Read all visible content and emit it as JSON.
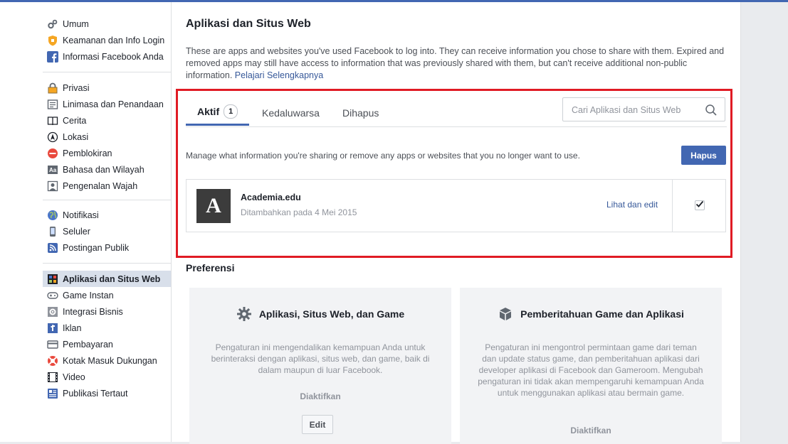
{
  "sidebar": {
    "items": [
      {
        "label": "Umum",
        "icon": "gears-icon"
      },
      {
        "label": "Keamanan dan Info Login",
        "icon": "shield-icon"
      },
      {
        "label": "Informasi Facebook Anda",
        "icon": "facebook-icon"
      },
      {
        "label": "Privasi",
        "icon": "lock-icon"
      },
      {
        "label": "Linimasa dan Penandaan",
        "icon": "timeline-icon"
      },
      {
        "label": "Cerita",
        "icon": "book-icon"
      },
      {
        "label": "Lokasi",
        "icon": "location-icon"
      },
      {
        "label": "Pemblokiran",
        "icon": "block-icon"
      },
      {
        "label": "Bahasa dan Wilayah",
        "icon": "language-icon"
      },
      {
        "label": "Pengenalan Wajah",
        "icon": "face-icon"
      },
      {
        "label": "Notifikasi",
        "icon": "globe-icon"
      },
      {
        "label": "Seluler",
        "icon": "mobile-icon"
      },
      {
        "label": "Postingan Publik",
        "icon": "rss-icon"
      },
      {
        "label": "Aplikasi dan Situs Web",
        "icon": "apps-icon",
        "active": true
      },
      {
        "label": "Game Instan",
        "icon": "gamepad-icon"
      },
      {
        "label": "Integrasi Bisnis",
        "icon": "business-icon"
      },
      {
        "label": "Iklan",
        "icon": "ads-icon"
      },
      {
        "label": "Pembayaran",
        "icon": "payment-icon"
      },
      {
        "label": "Kotak Masuk Dukungan",
        "icon": "lifebuoy-icon"
      },
      {
        "label": "Video",
        "icon": "film-icon"
      },
      {
        "label": "Publikasi Tertaut",
        "icon": "publication-icon"
      }
    ]
  },
  "main": {
    "title": "Aplikasi dan Situs Web",
    "description": "These are apps and websites you've used Facebook to log into. They can receive information you chose to share with them. Expired and removed apps may still have access to information that was previously shared with them, but can't receive additional non-public information.",
    "learn_more": "Pelajari Selengkapnya",
    "tabs": [
      {
        "label": "Aktif",
        "badge": "1",
        "active": true
      },
      {
        "label": "Kedaluwarsa"
      },
      {
        "label": "Dihapus"
      }
    ],
    "search_placeholder": "Cari Aplikasi dan Situs Web",
    "manage_text": "Manage what information you're sharing or remove any apps or websites that you no longer want to use.",
    "remove_button": "Hapus",
    "app": {
      "logo_letter": "A",
      "name": "Academia.edu",
      "added": "Ditambahkan pada 4 Mei 2015",
      "view_edit": "Lihat dan edit",
      "checked": true
    },
    "preferences_title": "Preferensi",
    "cards": [
      {
        "title": "Aplikasi, Situs Web, dan Game",
        "icon": "gear-icon",
        "text": "Pengaturan ini mengendalikan kemampuan Anda untuk berinteraksi dengan aplikasi, situs web, dan game, baik di dalam maupun di luar Facebook.",
        "status": "Diaktifkan",
        "button": "Edit"
      },
      {
        "title": "Pemberitahuan Game dan Aplikasi",
        "icon": "cube-icon",
        "text": "Pengaturan ini mengontrol permintaan game dari teman dan update status game, dan pemberitahuan aplikasi dari developer aplikasi di Facebook dan Gameroom. Mengubah pengaturan ini tidak akan mempengaruhi kemampuan Anda untuk menggunakan aplikasi atau bermain game.",
        "status": "Diaktifkan"
      }
    ]
  },
  "colors": {
    "accent": "#4267b2",
    "highlight": "#e01b24",
    "link": "#365899"
  }
}
